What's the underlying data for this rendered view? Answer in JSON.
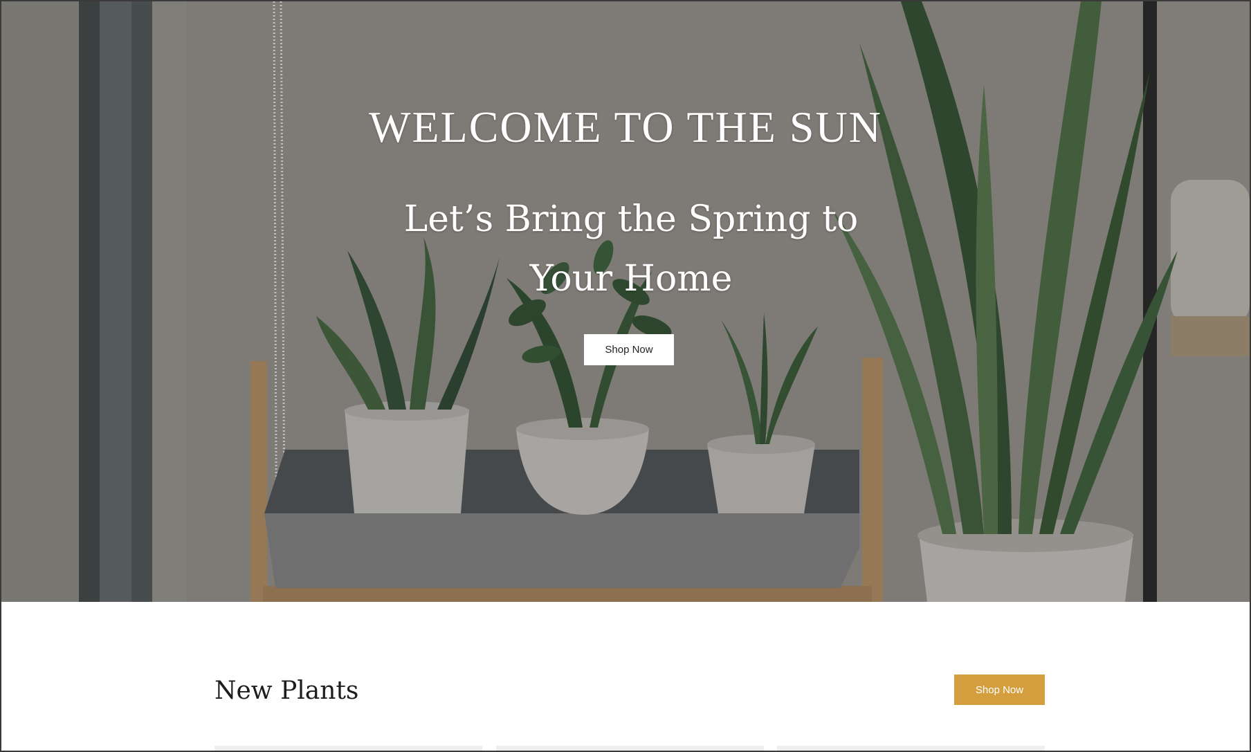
{
  "hero": {
    "eyebrow": "WELCOME TO THE SUN",
    "title": "Let’s Bring the Spring to Your Home",
    "button_label": "Shop Now",
    "image": "indoor-plants-on-shelf"
  },
  "new_plants": {
    "title": "New Plants",
    "button_label": "Shop Now",
    "cards": [
      "",
      "",
      ""
    ]
  },
  "colors": {
    "accent": "#d49d3e",
    "hero_text": "#ffffff",
    "heading_text": "#1d1d1d"
  }
}
